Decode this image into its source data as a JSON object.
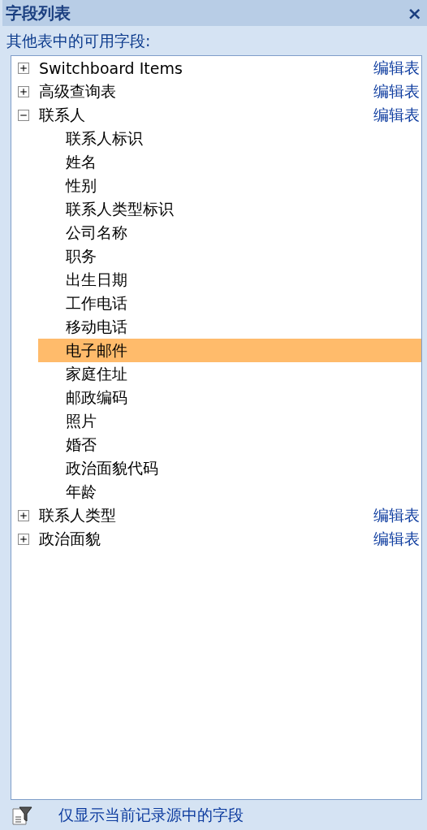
{
  "panel": {
    "title": "字段列表",
    "close": "×"
  },
  "section_label": "其他表中的可用字段:",
  "tables": [
    {
      "name": "Switchboard Items",
      "expanded": false,
      "edit_link": "编辑表"
    },
    {
      "name": "高级查询表",
      "expanded": false,
      "edit_link": "编辑表"
    },
    {
      "name": "联系人",
      "expanded": true,
      "edit_link": "编辑表",
      "children": [
        {
          "name": "联系人标识",
          "selected": false
        },
        {
          "name": "姓名",
          "selected": false
        },
        {
          "name": "性别",
          "selected": false
        },
        {
          "name": "联系人类型标识",
          "selected": false
        },
        {
          "name": "公司名称",
          "selected": false
        },
        {
          "name": "职务",
          "selected": false
        },
        {
          "name": "出生日期",
          "selected": false
        },
        {
          "name": "工作电话",
          "selected": false
        },
        {
          "name": "移动电话",
          "selected": false
        },
        {
          "name": "电子邮件",
          "selected": true
        },
        {
          "name": "家庭住址",
          "selected": false
        },
        {
          "name": "邮政编码",
          "selected": false
        },
        {
          "name": "照片",
          "selected": false
        },
        {
          "name": "婚否",
          "selected": false
        },
        {
          "name": "政治面貌代码",
          "selected": false
        },
        {
          "name": "年龄",
          "selected": false
        }
      ]
    },
    {
      "name": "联系人类型",
      "expanded": false,
      "edit_link": "编辑表"
    },
    {
      "name": "政治面貌",
      "expanded": false,
      "edit_link": "编辑表"
    }
  ],
  "footer_link": "仅显示当前记录源中的字段"
}
